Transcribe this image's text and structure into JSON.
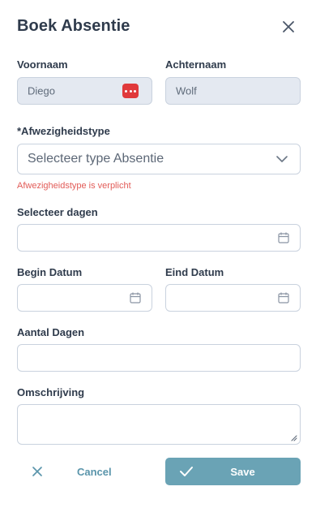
{
  "dialog": {
    "title": "Boek Absentie"
  },
  "fields": {
    "voornaam": {
      "label": "Voornaam",
      "value": "Diego"
    },
    "achternaam": {
      "label": "Achternaam",
      "value": "Wolf"
    },
    "afwezigheidstype": {
      "label": "*Afwezigheidstype",
      "placeholder": "Selecteer type Absentie",
      "error": "Afwezigheidstype is verplicht"
    },
    "selecteer_dagen": {
      "label": "Selecteer dagen",
      "value": ""
    },
    "begin_datum": {
      "label": "Begin Datum",
      "value": ""
    },
    "eind_datum": {
      "label": "Eind Datum",
      "value": ""
    },
    "aantal_dagen": {
      "label": "Aantal Dagen",
      "value": ""
    },
    "omschrijving": {
      "label": "Omschrijving",
      "value": ""
    }
  },
  "actions": {
    "cancel_label": "Cancel",
    "save_label": "Save"
  },
  "icons": {
    "close": "close-icon",
    "more": "more-dots-icon",
    "chevron": "chevron-down-icon",
    "calendar": "calendar-icon",
    "resize": "resize-handle-icon",
    "check": "check-icon"
  },
  "colors": {
    "accent": "#6aa3b5",
    "cancel_text": "#5a95ab",
    "error": "#e25b57",
    "badge": "#e0393b",
    "filled_bg": "#e4e9f1"
  }
}
